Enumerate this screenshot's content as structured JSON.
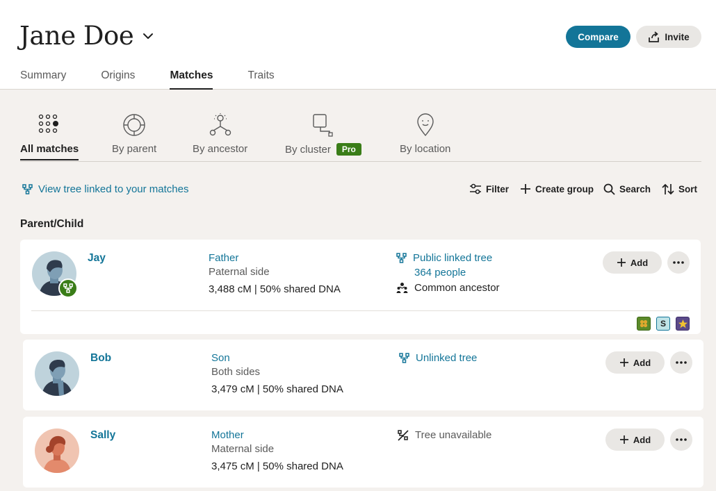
{
  "header": {
    "title": "Jane Doe",
    "compare_label": "Compare",
    "invite_label": "Invite"
  },
  "tabs": [
    {
      "label": "Summary"
    },
    {
      "label": "Origins"
    },
    {
      "label": "Matches",
      "active": true
    },
    {
      "label": "Traits"
    }
  ],
  "subtabs": [
    {
      "label": "All matches",
      "icon": "all-matches-icon",
      "active": true
    },
    {
      "label": "By parent",
      "icon": "parent-circle-icon"
    },
    {
      "label": "By ancestor",
      "icon": "ancestor-tree-icon"
    },
    {
      "label": "By cluster",
      "icon": "cluster-icon",
      "badge": "Pro"
    },
    {
      "label": "By location",
      "icon": "location-pin-icon"
    }
  ],
  "toolbar": {
    "tree_link": "View tree linked to your matches",
    "filter": "Filter",
    "create_group": "Create group",
    "search": "Search",
    "sort": "Sort"
  },
  "section_title": "Parent/Child",
  "matches": [
    {
      "name": "Jay",
      "relationship": "Father",
      "side": "Paternal side",
      "dna": "3,488 cM | 50% shared DNA",
      "tree_label": "Public linked tree",
      "tree_people": "364 people",
      "extra": "Common ancestor",
      "add_label": "Add",
      "tags": [
        "S"
      ]
    },
    {
      "name": "Bob",
      "relationship": "Son",
      "side": "Both sides",
      "dna": "3,479 cM | 50% shared DNA",
      "tree_label": "Unlinked tree",
      "add_label": "Add"
    },
    {
      "name": "Sally",
      "relationship": "Mother",
      "side": "Maternal side",
      "dna": "3,475 cM | 50% shared DNA",
      "tree_label": "Tree unavailable",
      "add_label": "Add"
    }
  ],
  "colors": {
    "accent": "#137598",
    "pro_badge": "#3a7d18",
    "background": "#f4f1ee"
  }
}
